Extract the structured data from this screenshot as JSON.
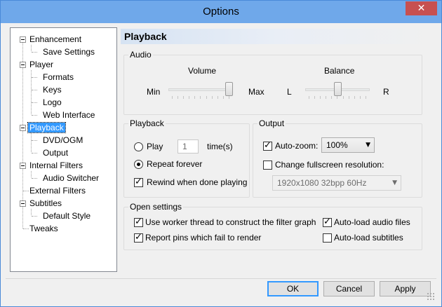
{
  "window": {
    "title": "Options",
    "close_symbol": "✕"
  },
  "tree": {
    "items": [
      {
        "label": "Enhancement"
      },
      {
        "label": "Save Settings"
      },
      {
        "label": "Player"
      },
      {
        "label": "Formats"
      },
      {
        "label": "Keys"
      },
      {
        "label": "Logo"
      },
      {
        "label": "Web Interface"
      },
      {
        "label": "Playback"
      },
      {
        "label": "DVD/OGM"
      },
      {
        "label": "Output"
      },
      {
        "label": "Internal Filters"
      },
      {
        "label": "Audio Switcher"
      },
      {
        "label": "External Filters"
      },
      {
        "label": "Subtitles"
      },
      {
        "label": "Default Style"
      },
      {
        "label": "Tweaks"
      }
    ],
    "selected": "Playback"
  },
  "panel": {
    "title": "Playback"
  },
  "audio": {
    "group_label": "Audio",
    "volume_label": "Volume",
    "min_label": "Min",
    "max_label": "Max",
    "volume_level": 1.0,
    "balance_label": "Balance",
    "left_label": "L",
    "right_label": "R",
    "balance_level": 0.5
  },
  "playback": {
    "group_label": "Playback",
    "play_label": "Play",
    "play_count": "1",
    "times_label": "time(s)",
    "repeat_label": "Repeat forever",
    "rewind_label": "Rewind when done playing",
    "repeat_selected": true,
    "rewind_checked": true
  },
  "output": {
    "group_label": "Output",
    "autozoom_label": "Auto-zoom:",
    "autozoom_checked": true,
    "autozoom_value": "100%",
    "fullscreen_label": "Change fullscreen resolution:",
    "fullscreen_checked": false,
    "resolution_value": "1920x1080 32bpp 60Hz"
  },
  "open_settings": {
    "group_label": "Open settings",
    "worker_thread_label": "Use worker thread to construct the filter graph",
    "report_pins_label": "Report pins which fail to render",
    "autoload_audio_label": "Auto-load audio files",
    "autoload_subs_label": "Auto-load subtitles",
    "worker_checked": true,
    "report_checked": true,
    "audio_checked": true,
    "subs_checked": false
  },
  "buttons": {
    "ok": "OK",
    "cancel": "Cancel",
    "apply": "Apply"
  },
  "icons": {
    "arrow": "▼"
  }
}
